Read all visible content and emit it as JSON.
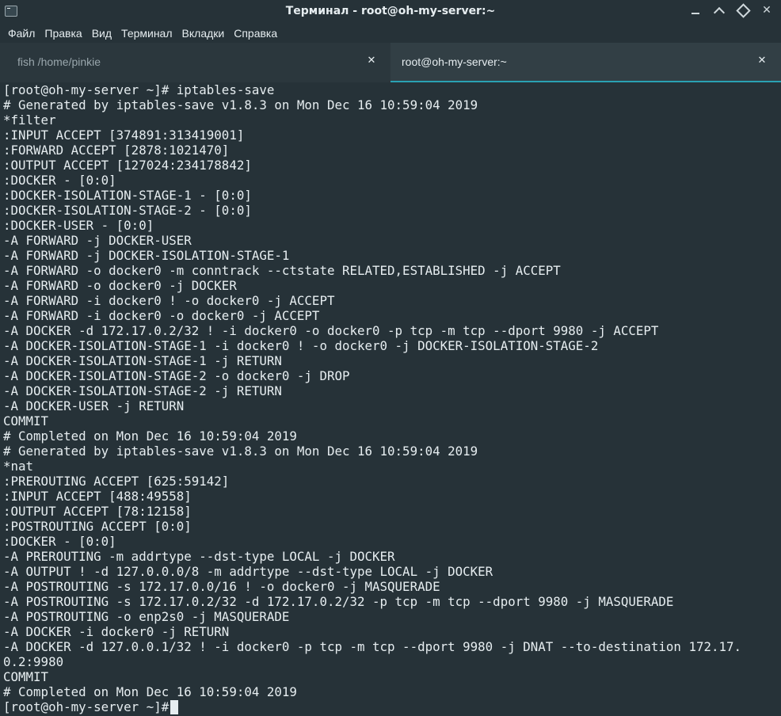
{
  "window": {
    "title": "Терминал - root@oh-my-server:~"
  },
  "menu": {
    "items": [
      "Файл",
      "Правка",
      "Вид",
      "Терминал",
      "Вкладки",
      "Справка"
    ]
  },
  "tabs": [
    {
      "label": "fish /home/pinkie",
      "active": false
    },
    {
      "label": "root@oh-my-server:~",
      "active": true
    }
  ],
  "terminal": {
    "lines": [
      "[root@oh-my-server ~]# iptables-save",
      "# Generated by iptables-save v1.8.3 on Mon Dec 16 10:59:04 2019",
      "*filter",
      ":INPUT ACCEPT [374891:313419001]",
      ":FORWARD ACCEPT [2878:1021470]",
      ":OUTPUT ACCEPT [127024:234178842]",
      ":DOCKER - [0:0]",
      ":DOCKER-ISOLATION-STAGE-1 - [0:0]",
      ":DOCKER-ISOLATION-STAGE-2 - [0:0]",
      ":DOCKER-USER - [0:0]",
      "-A FORWARD -j DOCKER-USER",
      "-A FORWARD -j DOCKER-ISOLATION-STAGE-1",
      "-A FORWARD -o docker0 -m conntrack --ctstate RELATED,ESTABLISHED -j ACCEPT",
      "-A FORWARD -o docker0 -j DOCKER",
      "-A FORWARD -i docker0 ! -o docker0 -j ACCEPT",
      "-A FORWARD -i docker0 -o docker0 -j ACCEPT",
      "-A DOCKER -d 172.17.0.2/32 ! -i docker0 -o docker0 -p tcp -m tcp --dport 9980 -j ACCEPT",
      "-A DOCKER-ISOLATION-STAGE-1 -i docker0 ! -o docker0 -j DOCKER-ISOLATION-STAGE-2",
      "-A DOCKER-ISOLATION-STAGE-1 -j RETURN",
      "-A DOCKER-ISOLATION-STAGE-2 -o docker0 -j DROP",
      "-A DOCKER-ISOLATION-STAGE-2 -j RETURN",
      "-A DOCKER-USER -j RETURN",
      "COMMIT",
      "# Completed on Mon Dec 16 10:59:04 2019",
      "# Generated by iptables-save v1.8.3 on Mon Dec 16 10:59:04 2019",
      "*nat",
      ":PREROUTING ACCEPT [625:59142]",
      ":INPUT ACCEPT [488:49558]",
      ":OUTPUT ACCEPT [78:12158]",
      ":POSTROUTING ACCEPT [0:0]",
      ":DOCKER - [0:0]",
      "-A PREROUTING -m addrtype --dst-type LOCAL -j DOCKER",
      "-A OUTPUT ! -d 127.0.0.0/8 -m addrtype --dst-type LOCAL -j DOCKER",
      "-A POSTROUTING -s 172.17.0.0/16 ! -o docker0 -j MASQUERADE",
      "-A POSTROUTING -s 172.17.0.2/32 -d 172.17.0.2/32 -p tcp -m tcp --dport 9980 -j MASQUERADE",
      "-A POSTROUTING -o enp2s0 -j MASQUERADE",
      "-A DOCKER -i docker0 -j RETURN",
      "-A DOCKER -d 127.0.0.1/32 ! -i docker0 -p tcp -m tcp --dport 9980 -j DNAT --to-destination 172.17.",
      "0.2:9980",
      "COMMIT",
      "# Completed on Mon Dec 16 10:59:04 2019"
    ],
    "prompt": "[root@oh-my-server ~]#"
  },
  "colors": {
    "background": "#263238",
    "foreground": "#e6edf0",
    "accent": "#2aa1b3"
  }
}
